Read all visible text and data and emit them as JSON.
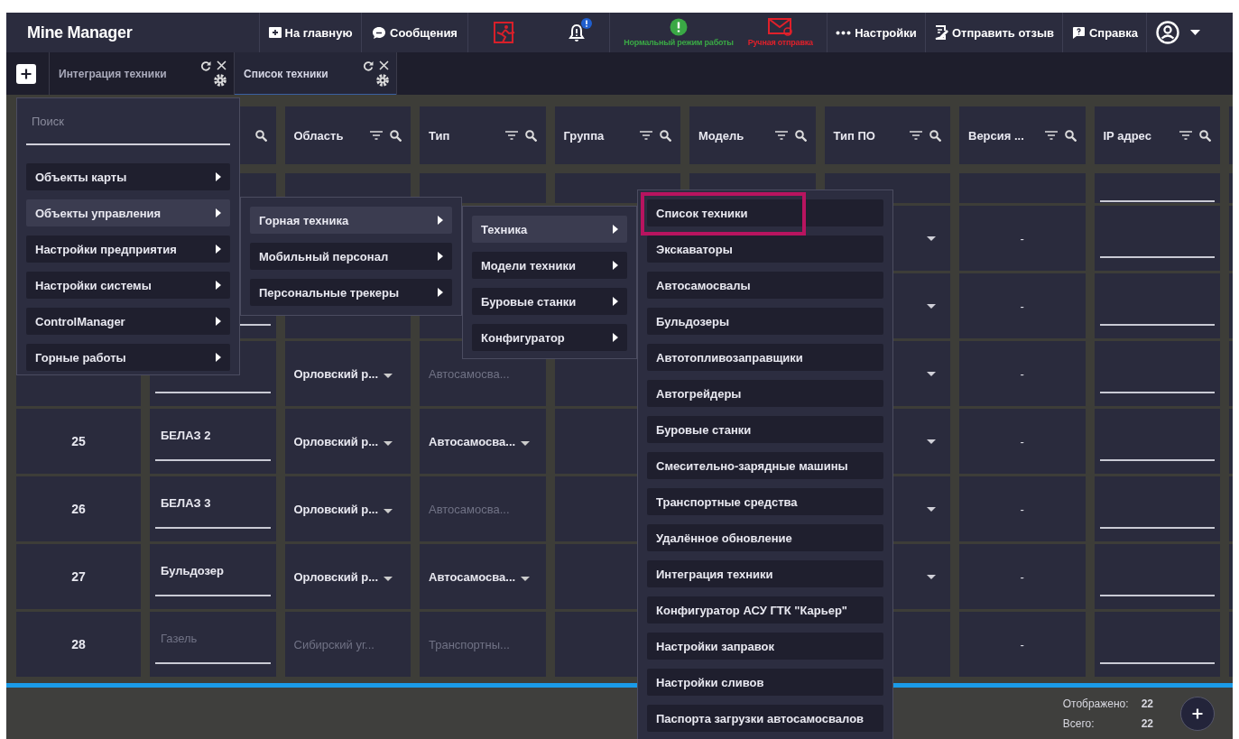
{
  "header": {
    "title": "Mine Manager",
    "nav": [
      {
        "kind": "home",
        "label": "На главную"
      },
      {
        "kind": "messages",
        "label": "Сообщения"
      }
    ],
    "alerts": [
      {
        "kind": "exit",
        "badge": false
      },
      {
        "kind": "bell",
        "badge": true
      }
    ],
    "statuses": [
      {
        "kind": "ok",
        "label": "Нормальный режим работы",
        "color": "#3aa845"
      },
      {
        "kind": "mail",
        "label": "Ручная отправка",
        "color": "#e0202a"
      }
    ],
    "actions": [
      {
        "kind": "more",
        "label": "Настройки"
      },
      {
        "kind": "feedback",
        "label": "Отправить отзыв"
      },
      {
        "kind": "help",
        "label": "Справка"
      }
    ]
  },
  "tabs": [
    {
      "label": "Интеграция техники",
      "selected": false
    },
    {
      "label": "Список техники",
      "selected": true
    }
  ],
  "table": {
    "columns": [
      {},
      {
        "filter": false,
        "search": true
      },
      {
        "label": "Область",
        "filter": true,
        "search": true
      },
      {
        "label": "Тип",
        "filter": true,
        "search": true
      },
      {
        "label": "Группа",
        "filter": true,
        "search": true
      },
      {
        "label": "Модель",
        "filter": true,
        "search": true
      },
      {
        "label": "Тип ПО",
        "filter": true,
        "search": true
      },
      {
        "label": "Версия ...",
        "filter": true,
        "search": true
      },
      {
        "label": "IP адрес",
        "filter": true,
        "search": true
      }
    ],
    "rows": [
      {
        "partial": true
      },
      {
        "software_type": {
          "disabled": false
        },
        "version": "-"
      },
      {
        "software_type": {
          "disabled": false
        },
        "version": "-"
      },
      {
        "area": {
          "text": "Орловский р...",
          "disabled": false
        },
        "type": {
          "text": "Автосамосва...",
          "disabled": true
        },
        "software_type": {
          "disabled": false
        },
        "version": "-"
      },
      {
        "number": "25",
        "name": {
          "text": "БЕЛАЗ 2",
          "disabled": false
        },
        "area": {
          "text": "Орловский р...",
          "disabled": false
        },
        "type": {
          "text": "Автосамосва...",
          "disabled": false
        },
        "software_type": {
          "disabled": false
        },
        "version": "-"
      },
      {
        "number": "26",
        "name": {
          "text": "БЕЛАЗ 3",
          "disabled": false
        },
        "area": {
          "text": "Орловский р...",
          "disabled": false
        },
        "type": {
          "text": "Автосамосва...",
          "disabled": true
        },
        "software_type": {
          "disabled": false
        },
        "version": "-"
      },
      {
        "number": "27",
        "name": {
          "text": "Бульдозер",
          "disabled": false
        },
        "area": {
          "text": "Орловский р...",
          "disabled": false
        },
        "type": {
          "text": "Автосамосва...",
          "disabled": false
        },
        "software_type": {
          "disabled": false
        },
        "version": "-"
      },
      {
        "number": "28",
        "name": {
          "text": "Газель",
          "disabled": true
        },
        "area": {
          "text": "Сибирский уг...",
          "disabled": true
        },
        "type": {
          "text": "Транспортны...",
          "disabled": true
        },
        "software_type": {
          "disabled": true
        },
        "version": "-"
      }
    ]
  },
  "menus": [
    {
      "search_placeholder": "Поиск",
      "items": [
        {
          "label": "Объекты карты",
          "selected": false,
          "submenu": true
        },
        {
          "label": "Объекты управления",
          "selected": true,
          "submenu": true
        },
        {
          "label": "Настройки предприятия",
          "selected": false,
          "submenu": true
        },
        {
          "label": "Настройки системы",
          "selected": false,
          "submenu": true
        },
        {
          "label": "ControlManager",
          "selected": false,
          "submenu": true
        },
        {
          "label": "Горные работы",
          "selected": false,
          "submenu": true
        }
      ]
    },
    {
      "items": [
        {
          "label": "Горная техника",
          "selected": true,
          "submenu": true
        },
        {
          "label": "Мобильный персонал",
          "selected": false,
          "submenu": true
        },
        {
          "label": "Персональные трекеры",
          "selected": false,
          "submenu": true
        }
      ]
    },
    {
      "items": [
        {
          "label": "Техника",
          "selected": true,
          "submenu": true
        },
        {
          "label": "Модели техники",
          "selected": false,
          "submenu": true
        },
        {
          "label": "Буровые станки",
          "selected": false,
          "submenu": true
        },
        {
          "label": "Конфигуратор",
          "selected": false,
          "submenu": true
        }
      ]
    },
    {
      "items": [
        {
          "label": "Список техники",
          "selected": false,
          "submenu": false,
          "highlighted": true
        },
        {
          "label": "Экскаваторы",
          "selected": false,
          "submenu": false,
          "highlighted": false
        },
        {
          "label": "Автосамосвалы",
          "selected": false,
          "submenu": false,
          "highlighted": false
        },
        {
          "label": "Бульдозеры",
          "selected": false,
          "submenu": false,
          "highlighted": false
        },
        {
          "label": "Автотопливозаправщики",
          "selected": false,
          "submenu": false,
          "highlighted": false
        },
        {
          "label": "Автогрейдеры",
          "selected": false,
          "submenu": false,
          "highlighted": false
        },
        {
          "label": "Буровые станки",
          "selected": false,
          "submenu": false,
          "highlighted": false
        },
        {
          "label": "Смесительно-зарядные машины",
          "selected": false,
          "submenu": false,
          "highlighted": false
        },
        {
          "label": "Транспортные средства",
          "selected": false,
          "submenu": false,
          "highlighted": false
        },
        {
          "label": "Удалённое обновление",
          "selected": false,
          "submenu": false,
          "highlighted": false
        },
        {
          "label": "Интеграция техники",
          "selected": false,
          "submenu": false,
          "highlighted": false
        },
        {
          "label": "Конфигуратор АСУ ГТК \"Карьер\"",
          "selected": false,
          "submenu": false,
          "highlighted": false
        },
        {
          "label": "Настройки заправок",
          "selected": false,
          "submenu": false,
          "highlighted": false
        },
        {
          "label": "Настройки сливов",
          "selected": false,
          "submenu": false,
          "highlighted": false
        },
        {
          "label": "Паспорта загрузки автосамосвалов",
          "selected": false,
          "submenu": false,
          "highlighted": false
        }
      ]
    }
  ],
  "footer": {
    "shown_label": "Отображено:",
    "shown": "22",
    "total_label": "Всего:",
    "total": "22"
  }
}
